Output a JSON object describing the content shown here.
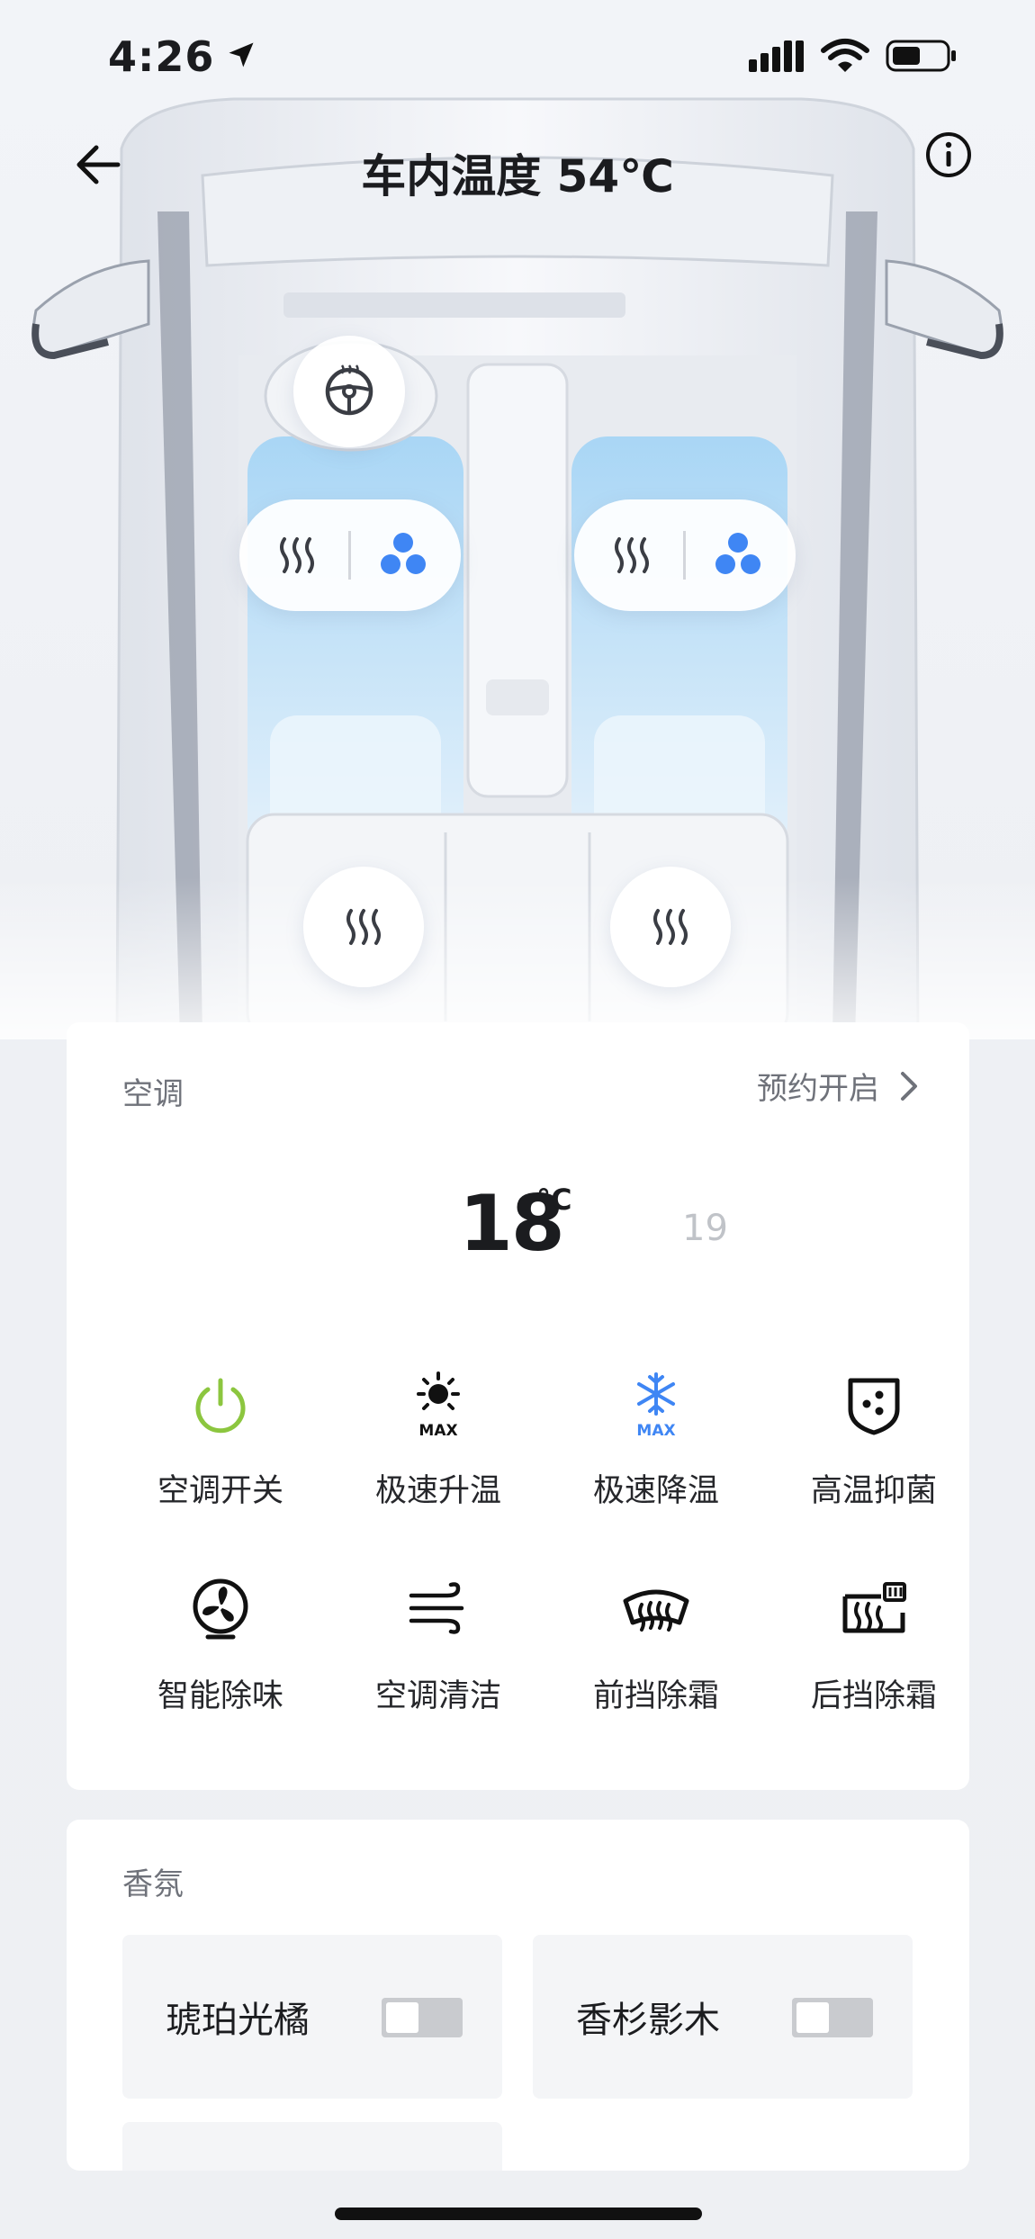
{
  "status_bar": {
    "time": "4:26"
  },
  "header": {
    "title": "车内温度 54℃"
  },
  "ac": {
    "section_label": "空调",
    "schedule_label": "预约开启",
    "temperature": "18",
    "temperature_unit": "°C",
    "next_temperature": "19",
    "controls": [
      {
        "label": "空调开关",
        "icon": "power-icon"
      },
      {
        "label": "极速升温",
        "icon": "sun-max-icon",
        "badge": "MAX"
      },
      {
        "label": "极速降温",
        "icon": "snowflake-max-icon",
        "badge": "MAX"
      },
      {
        "label": "高温抑菌",
        "icon": "shield-dots-icon"
      },
      {
        "label": "智能除味",
        "icon": "fan-icon"
      },
      {
        "label": "空调清洁",
        "icon": "wind-icon"
      },
      {
        "label": "前挡除霜",
        "icon": "front-defrost-icon"
      },
      {
        "label": "后挡除霜",
        "icon": "rear-defrost-icon"
      }
    ]
  },
  "fragrance": {
    "section_label": "香氛",
    "items": [
      {
        "label": "琥珀光橘",
        "enabled": false
      },
      {
        "label": "香杉影木",
        "enabled": false
      }
    ]
  },
  "colors": {
    "power_green": "#8cc63f",
    "cool_blue": "#3f86f4",
    "seat_blue": "#bfe0f7"
  }
}
